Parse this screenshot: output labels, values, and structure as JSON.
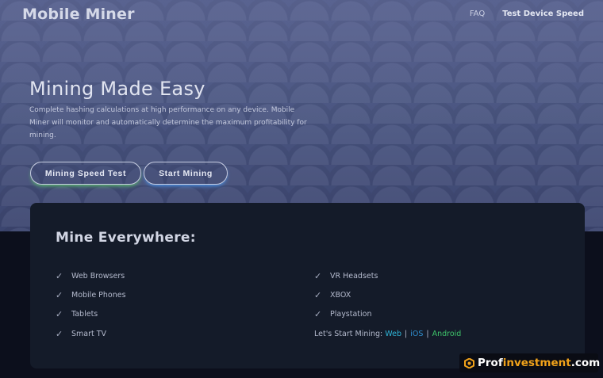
{
  "header": {
    "brand": "Mobile Miner",
    "nav": [
      {
        "label": "FAQ"
      },
      {
        "label": "Test Device Speed"
      }
    ]
  },
  "hero": {
    "title": "Mining Made Easy",
    "description": "Complete hashing calculations at high performance on any device. Mobile Miner will monitor and automatically determine the maximum profitability for mining.",
    "buttons": {
      "speed_test": "Mining Speed Test",
      "start": "Start Mining"
    }
  },
  "platforms": {
    "title": "Mine Everywhere:",
    "left": [
      "Web Browsers",
      "Mobile Phones",
      "Tablets",
      "Smart TV"
    ],
    "right": [
      "VR Headsets",
      "XBOX",
      "Playstation"
    ],
    "cta": {
      "label": "Let's Start Mining:",
      "links": [
        "Web",
        "iOS",
        "Android"
      ],
      "separator": "|"
    }
  },
  "watermark": {
    "part1": "Prof",
    "part2": "investment",
    "part3": ".com"
  },
  "icons": {
    "check": "check-icon",
    "logo": "profinvestment-logo"
  },
  "colors": {
    "hero_bg": "#4a5580",
    "page_bg": "#0c0f1c",
    "card_bg": "#141b29",
    "speed_glow": "#5fd36a",
    "start_glow": "#4aa0ff",
    "link_web": "#2fb5d8",
    "link_ios": "#2f8fd0",
    "link_android": "#3ec46a",
    "watermark_accent": "#f0a21a"
  }
}
